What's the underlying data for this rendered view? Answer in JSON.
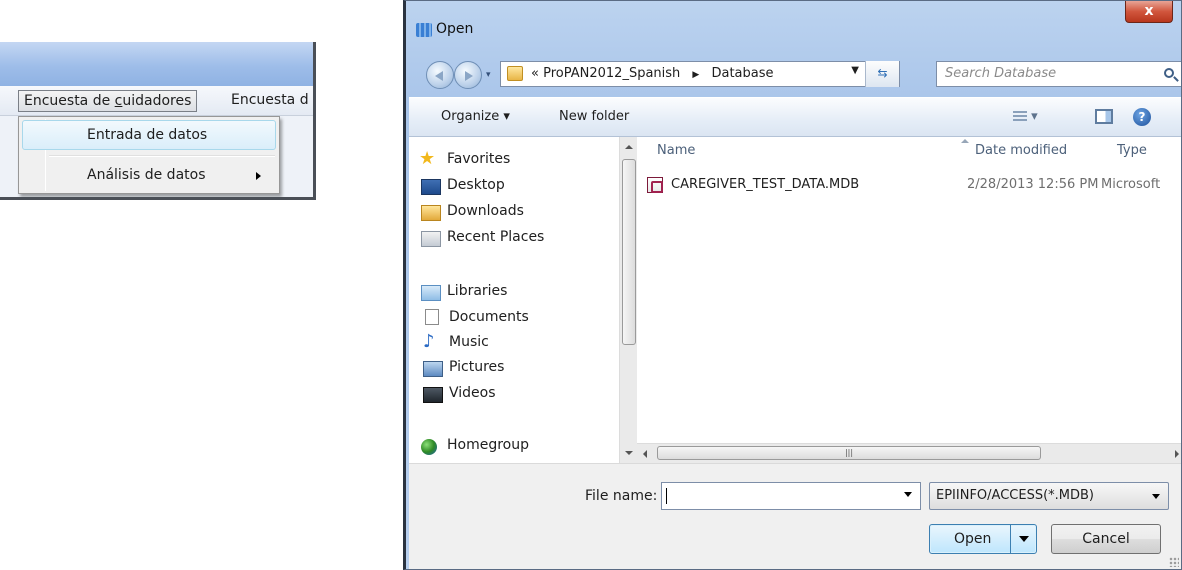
{
  "menu": {
    "top_items": [
      "Encuesta de ",
      "c",
      "uidadores",
      "Encuesta d"
    ],
    "dropdown_items": [
      "Entrada de datos",
      "Análisis de datos"
    ]
  },
  "dialog": {
    "title": "Open",
    "close_glyph": "x",
    "breadcrumb_prefix": "«",
    "breadcrumb": [
      "ProPAN2012_Spanish",
      "Database"
    ],
    "search_placeholder": "Search Database",
    "toolbar": {
      "organize": "Organize ▾",
      "new_folder": "New folder",
      "help_glyph": "?"
    },
    "nav": {
      "favorites": "Favorites",
      "desktop": "Desktop",
      "downloads": "Downloads",
      "recent_places": "Recent Places",
      "libraries": "Libraries",
      "documents": "Documents",
      "music": "Music",
      "pictures": "Pictures",
      "videos": "Videos",
      "homegroup": "Homegroup"
    },
    "columns": {
      "name": "Name",
      "date_modified": "Date modified",
      "type": "Type"
    },
    "files": [
      {
        "name": "CAREGIVER_TEST_DATA.MDB",
        "date": "2/28/2013 12:56 PM",
        "type": "Microsoft"
      }
    ],
    "file_name_label": "File name:",
    "file_name_value": "",
    "filter": "EPIINFO/ACCESS(*.MDB)",
    "open_label": "Open",
    "cancel_label": "Cancel"
  }
}
